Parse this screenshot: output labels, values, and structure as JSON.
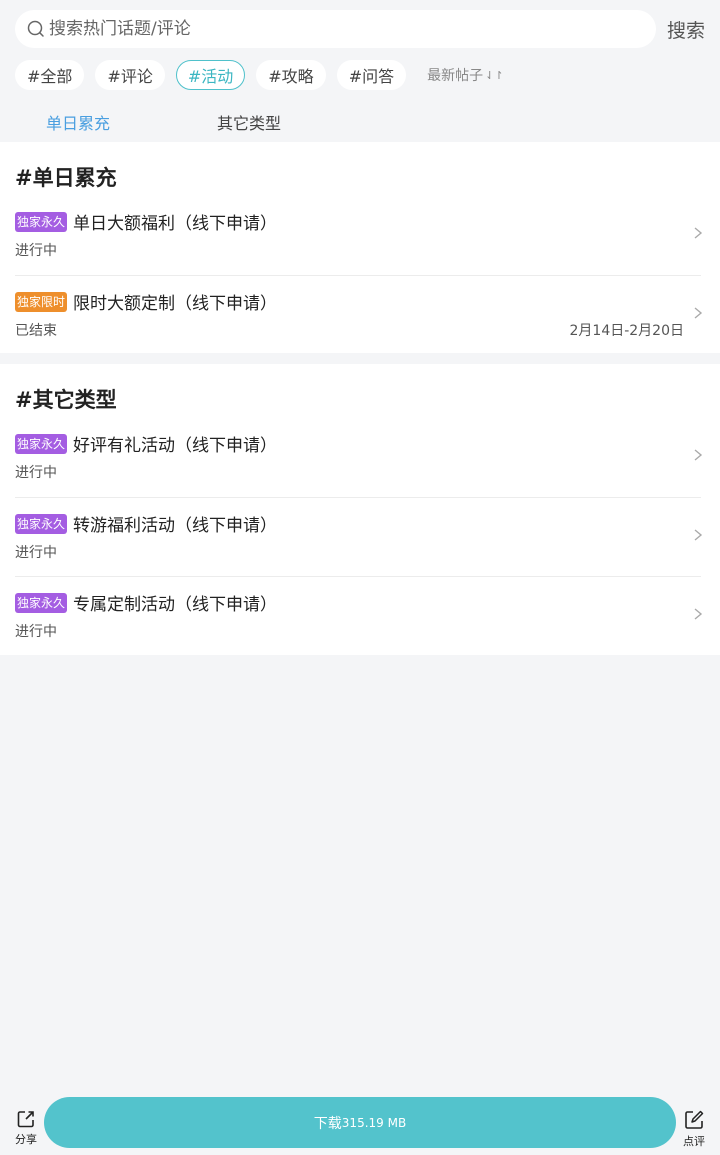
{
  "search": {
    "placeholder": "搜索热门话题/评论",
    "button_label": "搜索"
  },
  "chips": [
    {
      "label": "#全部",
      "active": false
    },
    {
      "label": "#评论",
      "active": false
    },
    {
      "label": "#活动",
      "active": true
    },
    {
      "label": "#攻略",
      "active": false
    },
    {
      "label": "#问答",
      "active": false
    }
  ],
  "sort": {
    "label": "最新帖子",
    "icon": "sort-arrows-icon"
  },
  "category_tabs": [
    {
      "label": "单日累充",
      "active": true
    },
    {
      "label": "其它类型",
      "active": false
    }
  ],
  "sections": [
    {
      "title": "#单日累充",
      "items": [
        {
          "badge": "独家永久",
          "badge_color": "#a45de2",
          "title": "单日大额福利（线下申请）",
          "status": "进行中",
          "date": ""
        },
        {
          "badge": "独家限时",
          "badge_color": "#ee8f2c",
          "title": "限时大额定制（线下申请）",
          "status": "已结束",
          "date": "2月14日-2月20日"
        }
      ]
    },
    {
      "title": "#其它类型",
      "items": [
        {
          "badge": "独家永久",
          "badge_color": "#a45de2",
          "title": "好评有礼活动（线下申请）",
          "status": "进行中",
          "date": ""
        },
        {
          "badge": "独家永久",
          "badge_color": "#a45de2",
          "title": "转游福利活动（线下申请）",
          "status": "进行中",
          "date": ""
        },
        {
          "badge": "独家永久",
          "badge_color": "#a45de2",
          "title": "专属定制活动（线下申请）",
          "status": "进行中",
          "date": ""
        }
      ]
    }
  ],
  "bottom": {
    "share_label": "分享",
    "download_label": "下载",
    "download_size": "315.19 MB",
    "review_label": "点评"
  },
  "colors": {
    "accent": "#4fc1cb",
    "tab_active": "#4a9fe0",
    "download": "#53c3cc"
  }
}
